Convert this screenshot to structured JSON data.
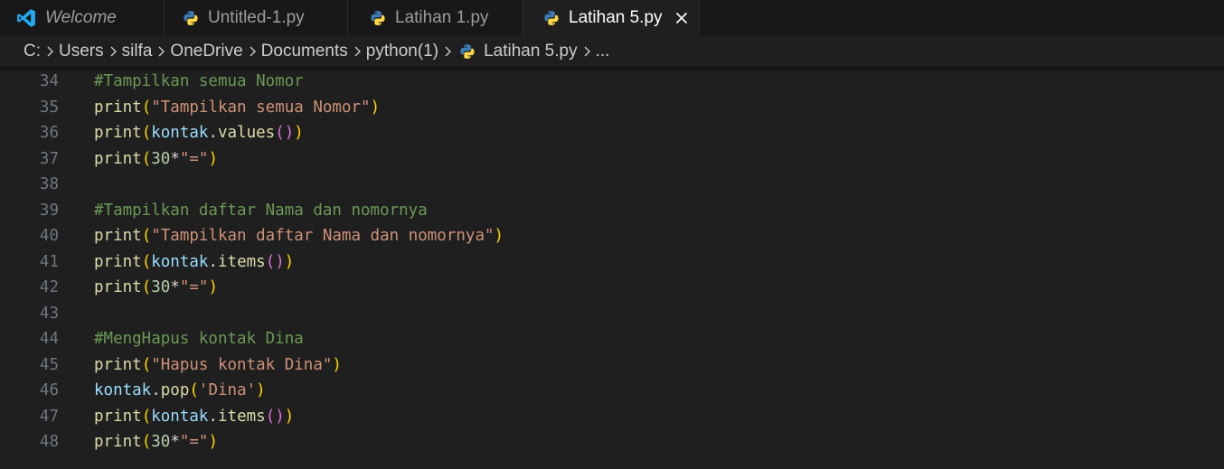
{
  "colors": {
    "tab_bar_bg": "#181818",
    "editor_bg": "#1f1f1f",
    "vscode_blue": "#23a9f2",
    "python_blue": "#3c7bb5",
    "python_yellow": "#ffd845",
    "comment": "#6a9955",
    "function": "#dcdcaa",
    "string": "#ce9178",
    "variable": "#9cdcfe",
    "number": "#b5cea8",
    "bracket1": "#ffd700",
    "bracket2": "#da70d6",
    "line_number": "#6e7681"
  },
  "tabs": [
    {
      "label": "Welcome",
      "icon": "vscode-logo-icon",
      "italic": true,
      "active": false
    },
    {
      "label": "Untitled-1.py",
      "icon": "python-icon",
      "italic": false,
      "active": false
    },
    {
      "label": "Latihan 1.py",
      "icon": "python-icon",
      "italic": false,
      "active": false
    },
    {
      "label": "Latihan 5.py",
      "icon": "python-icon",
      "italic": false,
      "active": true
    }
  ],
  "breadcrumb": [
    "C:",
    "Users",
    "silfa",
    "OneDrive",
    "Documents",
    "python(1)",
    "Latihan 5.py",
    "..."
  ],
  "lines": [
    {
      "n": "34",
      "tokens": [
        {
          "t": "#Tampilkan semua Nomor",
          "c": "comment"
        }
      ]
    },
    {
      "n": "35",
      "tokens": [
        {
          "t": "print",
          "c": "function"
        },
        {
          "t": "(",
          "c": "bracket1"
        },
        {
          "t": "\"Tampilkan semua Nomor\"",
          "c": "string"
        },
        {
          "t": ")",
          "c": "bracket1"
        }
      ]
    },
    {
      "n": "36",
      "tokens": [
        {
          "t": "print",
          "c": "function"
        },
        {
          "t": "(",
          "c": "bracket1"
        },
        {
          "t": "kontak",
          "c": "variable"
        },
        {
          "t": ".",
          "c": "plain"
        },
        {
          "t": "values",
          "c": "function"
        },
        {
          "t": "()",
          "c": "bracket2"
        },
        {
          "t": ")",
          "c": "bracket1"
        }
      ]
    },
    {
      "n": "37",
      "tokens": [
        {
          "t": "print",
          "c": "function"
        },
        {
          "t": "(",
          "c": "bracket1"
        },
        {
          "t": "30",
          "c": "number"
        },
        {
          "t": "*",
          "c": "plain"
        },
        {
          "t": "\"=\"",
          "c": "string"
        },
        {
          "t": ")",
          "c": "bracket1"
        }
      ]
    },
    {
      "n": "38",
      "tokens": []
    },
    {
      "n": "39",
      "tokens": [
        {
          "t": "#Tampilkan daftar Nama dan nomornya",
          "c": "comment"
        }
      ]
    },
    {
      "n": "40",
      "tokens": [
        {
          "t": "print",
          "c": "function"
        },
        {
          "t": "(",
          "c": "bracket1"
        },
        {
          "t": "\"Tampilkan daftar Nama dan nomornya\"",
          "c": "string"
        },
        {
          "t": ")",
          "c": "bracket1"
        }
      ]
    },
    {
      "n": "41",
      "tokens": [
        {
          "t": "print",
          "c": "function"
        },
        {
          "t": "(",
          "c": "bracket1"
        },
        {
          "t": "kontak",
          "c": "variable"
        },
        {
          "t": ".",
          "c": "plain"
        },
        {
          "t": "items",
          "c": "function"
        },
        {
          "t": "()",
          "c": "bracket2"
        },
        {
          "t": ")",
          "c": "bracket1"
        }
      ]
    },
    {
      "n": "42",
      "tokens": [
        {
          "t": "print",
          "c": "function"
        },
        {
          "t": "(",
          "c": "bracket1"
        },
        {
          "t": "30",
          "c": "number"
        },
        {
          "t": "*",
          "c": "plain"
        },
        {
          "t": "\"=\"",
          "c": "string"
        },
        {
          "t": ")",
          "c": "bracket1"
        }
      ]
    },
    {
      "n": "43",
      "tokens": []
    },
    {
      "n": "44",
      "tokens": [
        {
          "t": "#MengHapus kontak Dina",
          "c": "comment"
        }
      ]
    },
    {
      "n": "45",
      "tokens": [
        {
          "t": "print",
          "c": "function"
        },
        {
          "t": "(",
          "c": "bracket1"
        },
        {
          "t": "\"Hapus kontak Dina\"",
          "c": "string"
        },
        {
          "t": ")",
          "c": "bracket1"
        }
      ]
    },
    {
      "n": "46",
      "tokens": [
        {
          "t": "kontak",
          "c": "variable"
        },
        {
          "t": ".",
          "c": "plain"
        },
        {
          "t": "pop",
          "c": "function"
        },
        {
          "t": "(",
          "c": "bracket1"
        },
        {
          "t": "'Dina'",
          "c": "string"
        },
        {
          "t": ")",
          "c": "bracket1"
        }
      ]
    },
    {
      "n": "47",
      "tokens": [
        {
          "t": "print",
          "c": "function"
        },
        {
          "t": "(",
          "c": "bracket1"
        },
        {
          "t": "kontak",
          "c": "variable"
        },
        {
          "t": ".",
          "c": "plain"
        },
        {
          "t": "items",
          "c": "function"
        },
        {
          "t": "()",
          "c": "bracket2"
        },
        {
          "t": ")",
          "c": "bracket1"
        }
      ]
    },
    {
      "n": "48",
      "tokens": [
        {
          "t": "print",
          "c": "function"
        },
        {
          "t": "(",
          "c": "bracket1"
        },
        {
          "t": "30",
          "c": "number"
        },
        {
          "t": "*",
          "c": "plain"
        },
        {
          "t": "\"=\"",
          "c": "string"
        },
        {
          "t": ")",
          "c": "bracket1"
        }
      ]
    }
  ]
}
